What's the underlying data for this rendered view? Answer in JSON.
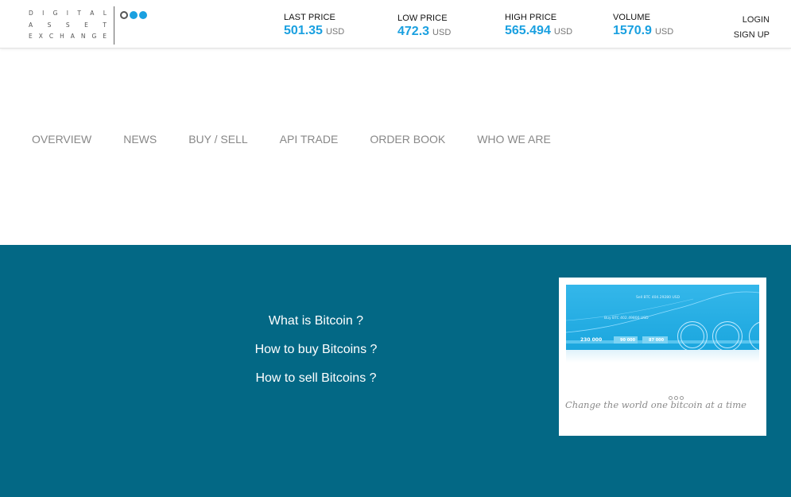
{
  "logo": {
    "lines": [
      [
        "D",
        "I",
        "G",
        "I",
        "T",
        "A",
        "L"
      ],
      [
        "A",
        "S",
        "S",
        "E",
        "T"
      ],
      [
        "E",
        "X",
        "C",
        "H",
        "A",
        "N",
        "G",
        "E"
      ]
    ]
  },
  "stats": {
    "last": {
      "label": "LAST PRICE",
      "value": "501.35",
      "unit": "USD"
    },
    "low": {
      "label": "LOW PRICE",
      "value": "472.3",
      "unit": "USD"
    },
    "high": {
      "label": "HIGH PRICE",
      "value": "565.494",
      "unit": "USD"
    },
    "volume": {
      "label": "VOLUME",
      "value": "1570.9",
      "unit": "USD"
    }
  },
  "auth": {
    "login": "LOGIN",
    "signup": "SIGN UP"
  },
  "nav": [
    "OVERVIEW",
    "NEWS",
    "BUY / SELL",
    "API TRADE",
    "ORDER BOOK",
    "WHO WE ARE"
  ],
  "links": [
    "What is Bitcoin ?",
    "How to buy Bitcoins ?",
    "How to sell Bitcoins ?"
  ],
  "promo": {
    "sell_text": "Sell BTC 404.29280 USD",
    "buy_text": "Buy BTC 402.49800 USD",
    "num1": "230 000",
    "num2": "90 000",
    "num3": "87 000",
    "tagline": "Change the world one bitcoin at a time"
  },
  "colors": {
    "accent": "#1aa0e0",
    "band": "#036885"
  }
}
